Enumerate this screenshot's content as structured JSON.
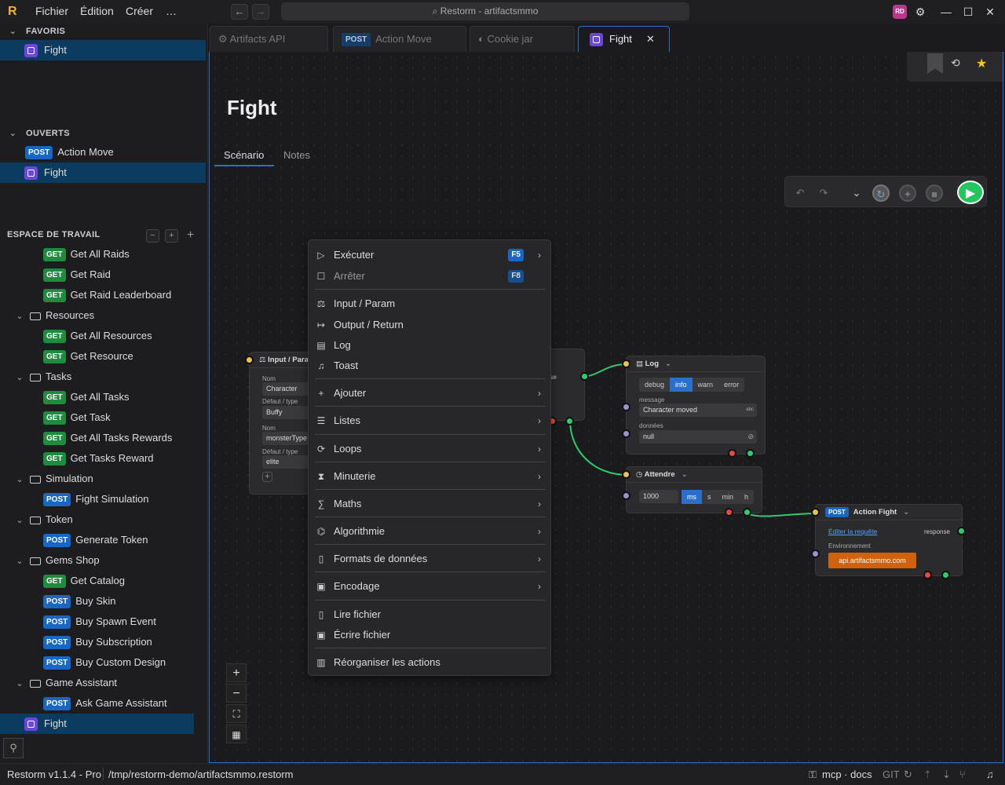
{
  "titlebar": {
    "menus": [
      "Fichier",
      "Édition",
      "Créer",
      "…"
    ],
    "search": "Restorm - artifactsmmo",
    "avatar": "RD"
  },
  "sidebar": {
    "favorites": {
      "title": "FAVORIS",
      "items": [
        {
          "label": "Fight"
        }
      ]
    },
    "open": {
      "title": "OUVERTS",
      "items": [
        {
          "method": "POST",
          "label": "Action Move"
        },
        {
          "label": "Fight"
        }
      ]
    },
    "workspace": {
      "title": "ESPACE DE TRAVAIL",
      "rows": [
        {
          "method": "GET",
          "label": "Get All Raids"
        },
        {
          "method": "GET",
          "label": "Get Raid"
        },
        {
          "method": "GET",
          "label": "Get Raid Leaderboard"
        },
        {
          "folder": "Resources"
        },
        {
          "method": "GET",
          "label": "Get All Resources"
        },
        {
          "method": "GET",
          "label": "Get Resource"
        },
        {
          "folder": "Tasks"
        },
        {
          "method": "GET",
          "label": "Get All Tasks"
        },
        {
          "method": "GET",
          "label": "Get Task"
        },
        {
          "method": "GET",
          "label": "Get All Tasks Rewards"
        },
        {
          "method": "GET",
          "label": "Get Tasks Reward"
        },
        {
          "folder": "Simulation"
        },
        {
          "method": "POST",
          "label": "Fight Simulation"
        },
        {
          "folder": "Token"
        },
        {
          "method": "POST",
          "label": "Generate Token"
        },
        {
          "folder": "Gems Shop"
        },
        {
          "method": "GET",
          "label": "Get Catalog"
        },
        {
          "method": "POST",
          "label": "Buy Skin"
        },
        {
          "method": "POST",
          "label": "Buy Spawn Event"
        },
        {
          "method": "POST",
          "label": "Buy Subscription"
        },
        {
          "method": "POST",
          "label": "Buy Custom Design"
        },
        {
          "folder": "Game Assistant"
        },
        {
          "method": "POST",
          "label": "Ask Game Assistant"
        },
        {
          "label": "Fight"
        }
      ]
    }
  },
  "tabs": [
    {
      "label": "Artifacts API"
    },
    {
      "method": "POST",
      "label": "Action Move"
    },
    {
      "label": "Cookie jar"
    },
    {
      "label": "Fight",
      "close": "✕"
    }
  ],
  "main": {
    "title": "Fight",
    "subtabs": [
      "Scénario",
      "Notes"
    ]
  },
  "nodes": {
    "input": {
      "title": "Input / Para",
      "nom1": "Nom",
      "v1": "Character",
      "def1": "Défaut / type",
      "d1": "Buffy",
      "nom2": "Nom",
      "v2": "monsterType",
      "def2": "Défaut / type",
      "d2": "elite"
    },
    "response_label": "sponse",
    "log": {
      "title": "Log",
      "levels": [
        "debug",
        "info",
        "warn",
        "error"
      ],
      "msg_label": "message",
      "msg": "Character moved",
      "msg_tag": "abc",
      "data_label": "données",
      "data": "null"
    },
    "wait": {
      "title": "Attendre",
      "value": "1000",
      "units": [
        "ms",
        "s",
        "min",
        "h"
      ]
    },
    "fight": {
      "method": "POST",
      "title": "Action Fight",
      "link": "Éditer la requête",
      "response": "response",
      "env_label": "Environnement",
      "env": "api.artifactsmmo.com"
    }
  },
  "context_menu": {
    "items": [
      {
        "label": "Exécuter",
        "key": "F5",
        "sub": true
      },
      {
        "label": "Arrêter",
        "key": "F8",
        "disabled": true
      },
      {
        "label": "Input / Param"
      },
      {
        "label": "Output / Return"
      },
      {
        "label": "Log"
      },
      {
        "label": "Toast"
      },
      {
        "label": "Ajouter",
        "sub": true
      },
      {
        "label": "Listes",
        "sub": true
      },
      {
        "label": "Loops",
        "sub": true
      },
      {
        "label": "Minuterie",
        "sub": true
      },
      {
        "label": "Maths",
        "sub": true
      },
      {
        "label": "Algorithmie",
        "sub": true
      },
      {
        "label": "Formats de données",
        "sub": true
      },
      {
        "label": "Encodage",
        "sub": true
      },
      {
        "label": "Lire fichier"
      },
      {
        "label": "Écrire fichier"
      },
      {
        "label": "Réorganiser les actions"
      }
    ]
  },
  "statusbar": {
    "version": "Restorm v1.1.4 - Pro",
    "path": "/tmp/restorm-demo/artifactsmmo.restorm",
    "mcp": "mcp · docs",
    "git": "GIT"
  },
  "colors": {
    "accent": "#2a6fcc",
    "get": "#1e8b3e",
    "post": "#1967c4",
    "scenario": "#6a47d8",
    "run": "#22c55e"
  }
}
